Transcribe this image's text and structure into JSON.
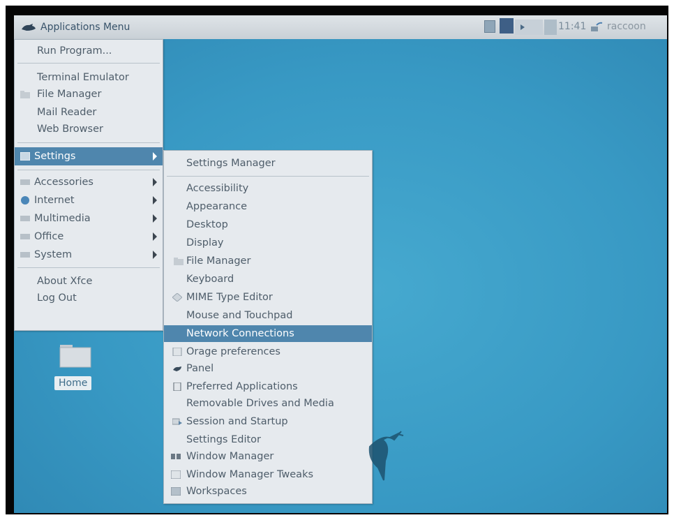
{
  "panel": {
    "apps_menu_label": "Applications Menu",
    "clock": "11:41",
    "user": "raccoon"
  },
  "main_menu": {
    "items": [
      {
        "label": "Run Program..."
      },
      {
        "label": "Terminal Emulator"
      },
      {
        "label": "File Manager"
      },
      {
        "label": "Mail Reader"
      },
      {
        "label": "Web Browser"
      },
      {
        "label": "Settings",
        "submenu": true,
        "highlighted": true
      },
      {
        "label": "Accessories",
        "submenu": true
      },
      {
        "label": "Internet",
        "submenu": true
      },
      {
        "label": "Multimedia",
        "submenu": true
      },
      {
        "label": "Office",
        "submenu": true
      },
      {
        "label": "System",
        "submenu": true
      },
      {
        "label": "About Xfce"
      },
      {
        "label": "Log Out"
      }
    ]
  },
  "settings_menu": {
    "items": [
      {
        "label": "Settings Manager"
      },
      {
        "label": "Accessibility"
      },
      {
        "label": "Appearance"
      },
      {
        "label": "Desktop"
      },
      {
        "label": "Display"
      },
      {
        "label": "File Manager"
      },
      {
        "label": "Keyboard"
      },
      {
        "label": "MIME Type Editor"
      },
      {
        "label": "Mouse and Touchpad"
      },
      {
        "label": "Network Connections",
        "highlighted": true
      },
      {
        "label": "Orage preferences"
      },
      {
        "label": "Panel"
      },
      {
        "label": "Preferred Applications"
      },
      {
        "label": "Removable Drives and Media"
      },
      {
        "label": "Session and Startup"
      },
      {
        "label": "Settings Editor"
      },
      {
        "label": "Window Manager"
      },
      {
        "label": "Window Manager Tweaks"
      },
      {
        "label": "Workspaces"
      }
    ]
  },
  "desktop": {
    "home_label": "Home"
  },
  "colors": {
    "desktop": "#3899c4",
    "menu_bg": "#e6eaee",
    "highlight": "#4f86ad",
    "menu_text": "#4e5d6a"
  }
}
